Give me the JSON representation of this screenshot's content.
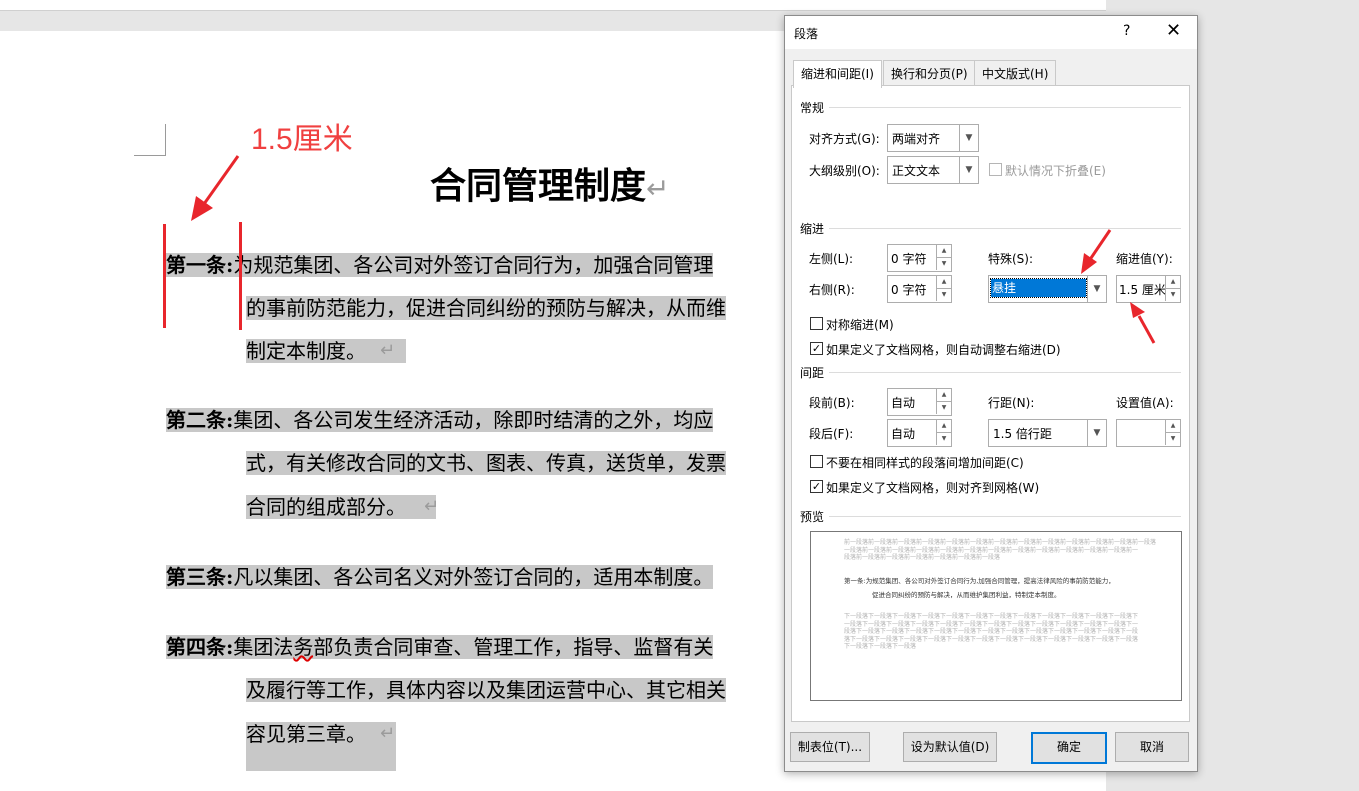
{
  "document": {
    "title": "合同管理制度",
    "return_mark": "↵",
    "paragraphs": [
      {
        "label": "第一条:",
        "lines": [
          "为规范集团、各公司对外签订合同行为，加强合同管理",
          "的事前防范能力，促进合同纠纷的预防与解决，从而维",
          "制定本制度。"
        ]
      },
      {
        "label": "第二条:",
        "lines": [
          "集团、各公司发生经济活动，除即时结清的之外，均应",
          "式，有关修改合同的文书、图表、传真，送货单，发票",
          "合同的组成部分。"
        ]
      },
      {
        "label": "第三条:",
        "lines": [
          "凡以集团、各公司名义对外签订合同的，适用本制度。"
        ]
      },
      {
        "label": "第四条:",
        "lines_parts": [
          [
            "集团法",
            "务",
            "部负责合同审查、管理工作，指导、监督有关"
          ],
          [
            "及履行等工作，具体内容以及集团运营中心、其它相关"
          ],
          [
            "容见第三章。"
          ]
        ]
      }
    ]
  },
  "annotation": {
    "text": "1.5厘米",
    "color": "#f04040"
  },
  "dialog": {
    "title": "段落",
    "help": "?",
    "close": "✕",
    "tabs": [
      "缩进和间距(I)",
      "换行和分页(P)",
      "中文版式(H)"
    ],
    "general": {
      "heading": "常规",
      "alignment_label": "对齐方式(G):",
      "alignment_value": "两端对齐",
      "outline_label": "大纲级别(O):",
      "outline_value": "正文文本",
      "collapse_label": "默认情况下折叠(E)"
    },
    "indent": {
      "heading": "缩进",
      "left_label": "左侧(L):",
      "left_value": "0 字符",
      "right_label": "右侧(R):",
      "right_value": "0 字符",
      "special_label": "特殊(S):",
      "special_value": "悬挂",
      "by_label": "缩进值(Y):",
      "by_value": "1.5 厘米",
      "mirror_label": "对称缩进(M)",
      "auto_adjust_label": "如果定义了文档网格，则自动调整右缩进(D)"
    },
    "spacing": {
      "heading": "间距",
      "before_label": "段前(B):",
      "before_value": "自动",
      "after_label": "段后(F):",
      "after_value": "自动",
      "line_label": "行距(N):",
      "line_value": "1.5 倍行距",
      "at_label": "设置值(A):",
      "at_value": "",
      "no_space_label": "不要在相同样式的段落间增加间距(C)",
      "snap_grid_label": "如果定义了文档网格，则对齐到网格(W)"
    },
    "preview": {
      "heading": "预览",
      "prev_lines": [
        "前一段落前一段落前一段落前一段落前一段落前一段落前一段落前一段落前一段落前一段落前一段落前一段落前一段落",
        "一段落前一段落前一段落前一段落前一段落前一段落前一段落前一段落前一段落前一段落前一段落前一段落前一",
        "段落前一段落前一段落前一段落前一段落前一段落前一段落"
      ],
      "main_line_1": "第一条:为规范集团、各公司对外签订合同行为,加强合同管理，提高法律风险的事前防范能力，",
      "main_line_2": "促进合同纠纷的预防与解决，从而维护集团利益，特制定本制度。",
      "next_lines": [
        "下一段落下一段落下一段落下一段落下一段落下一段落下一段落下一段落下一段落下一段落下一段落下一段落下",
        "一段落下一段落下一段落下一段落下一段落下一段落下一段落下一段落下一段落下一段落下一段落下一段落下一",
        "段落下一段落下一段落下一段落下一段落下一段落下一段落下一段落下一段落下一段落下一段落下一段落下一段",
        "落下一段落下一段落下一段落下一段落下一段落下一段落下一段落下一段落下一段落下一段落下一段落下一段落",
        "下一段落下一段落下一段落"
      ]
    },
    "buttons": {
      "tabs": "制表位(T)...",
      "default": "设为默认值(D)",
      "ok": "确定",
      "cancel": "取消"
    }
  }
}
